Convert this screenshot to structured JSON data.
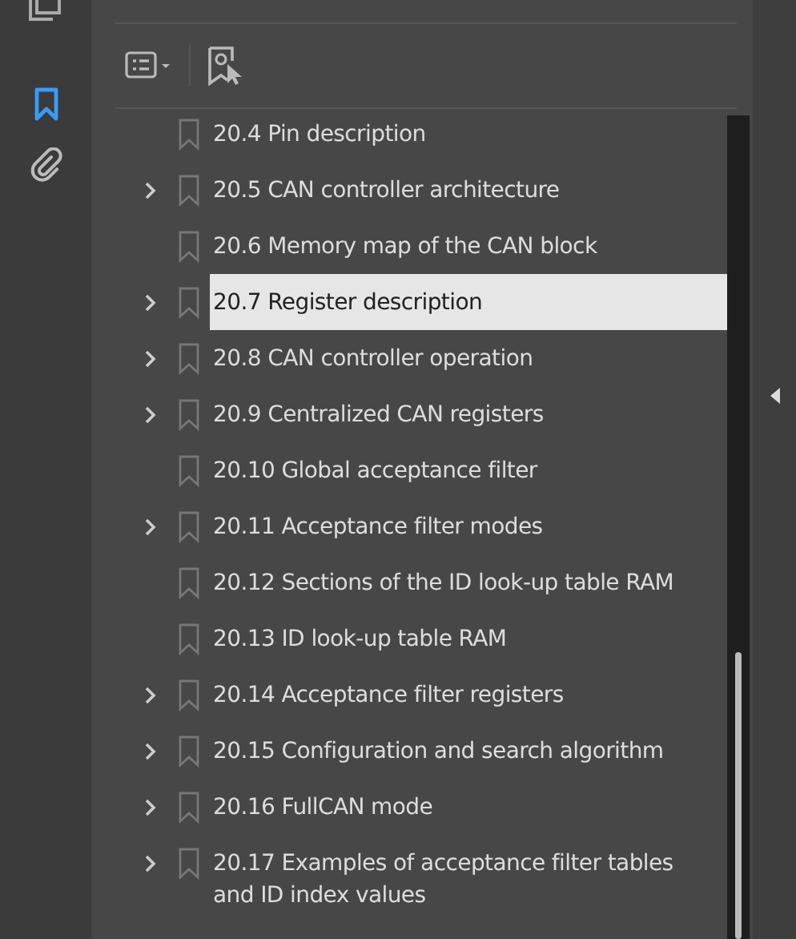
{
  "bookmarks": [
    {
      "label": "20.4 Pin description",
      "expandable": false,
      "selected": false
    },
    {
      "label": "20.5 CAN controller architecture",
      "expandable": true,
      "selected": false
    },
    {
      "label": "20.6 Memory map of the CAN block",
      "expandable": false,
      "selected": false
    },
    {
      "label": "20.7 Register description",
      "expandable": true,
      "selected": true
    },
    {
      "label": "20.8 CAN controller operation",
      "expandable": true,
      "selected": false
    },
    {
      "label": "20.9 Centralized CAN registers",
      "expandable": true,
      "selected": false
    },
    {
      "label": "20.10 Global acceptance filter",
      "expandable": false,
      "selected": false
    },
    {
      "label": "20.11 Acceptance filter modes",
      "expandable": true,
      "selected": false
    },
    {
      "label": "20.12 Sections of the ID look-up table RAM",
      "expandable": false,
      "selected": false
    },
    {
      "label": "20.13 ID look-up table RAM",
      "expandable": false,
      "selected": false
    },
    {
      "label": "20.14 Acceptance filter registers",
      "expandable": true,
      "selected": false
    },
    {
      "label": "20.15 Configuration and search algorithm",
      "expandable": true,
      "selected": false
    },
    {
      "label": "20.16 FullCAN mode",
      "expandable": true,
      "selected": false
    },
    {
      "label": "20.17 Examples of acceptance filter tables and ID index values",
      "expandable": true,
      "selected": false
    }
  ]
}
